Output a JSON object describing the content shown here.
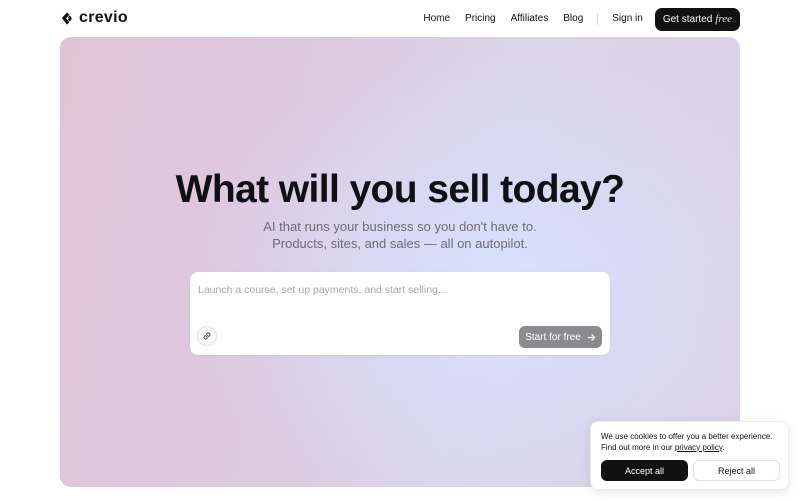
{
  "nav": {
    "logo_text": "crevio",
    "logo_icon": "crevio-logo-icon",
    "links": [
      "Home",
      "Pricing",
      "Affiliates",
      "Blog"
    ],
    "sign_in": "Sign in",
    "cta_label": "Get started",
    "cta_emphasis": "free"
  },
  "hero": {
    "title": "What will you sell today?",
    "subtitle_line1": "AI that runs your business so you don't have to.",
    "subtitle_line2": "Products, sites, and sales — all on autopilot.",
    "prompt": {
      "placeholder": "Launch a course, set up payments, and start selling...",
      "value": "",
      "attach_icon": "attachment-icon",
      "submit_label": "Start for free",
      "submit_icon": "arrow-right-icon"
    }
  },
  "cookie_banner": {
    "text_line1": "We use cookies to offer you a better experience.",
    "text_line2_prefix": "Find out more in our ",
    "policy_link": "privacy policy",
    "text_line2_suffix": ".",
    "accept_label": "Accept all",
    "reject_label": "Reject all"
  },
  "colors": {
    "brand_dark": "#111111",
    "hero_pink": "#e2c3d6",
    "hero_blue": "#d7e1ff",
    "submit_disabled": "#8b8b8f"
  }
}
